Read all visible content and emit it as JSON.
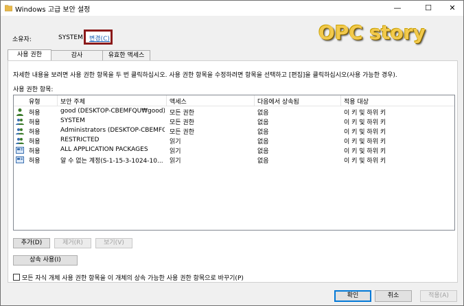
{
  "window": {
    "title": "Windows 고급 보안 설정",
    "minimize": "—",
    "maximize": "☐",
    "close": "✕"
  },
  "owner": {
    "label": "소유자:",
    "value": "SYSTEM",
    "change_link": "변경(C)"
  },
  "watermark": "OPC story",
  "tabs": [
    {
      "label": "사용 권한",
      "active": true
    },
    {
      "label": "감사",
      "active": false
    },
    {
      "label": "유효한 액세스",
      "active": false
    }
  ],
  "description": "자세한 내용을 보려면 사용 권한 항목을 두 번 클릭하십시오. 사용 권한 항목을 수정하려면 항목을 선택하고 [편집]을 클릭하십시오(사용 가능한 경우).",
  "entries_label": "사용 권한 항목:",
  "columns": [
    "유형",
    "보안 주체",
    "액세스",
    "다음에서 상속됨",
    "적용 대상"
  ],
  "rows": [
    {
      "icon": "user-icon",
      "type": "허용",
      "principal": "good (DESKTOP-CBEMFQU₩good)",
      "access": "모든 권한",
      "inherited": "없음",
      "applies": "이 키 및 하위 키"
    },
    {
      "icon": "group-icon",
      "type": "허용",
      "principal": "SYSTEM",
      "access": "모든 권한",
      "inherited": "없음",
      "applies": "이 키 및 하위 키"
    },
    {
      "icon": "group-icon",
      "type": "허용",
      "principal": "Administrators (DESKTOP-CBEMFQ...",
      "access": "모든 권한",
      "inherited": "없음",
      "applies": "이 키 및 하위 키"
    },
    {
      "icon": "group-icon",
      "type": "허용",
      "principal": "RESTRICTED",
      "access": "읽기",
      "inherited": "없음",
      "applies": "이 키 및 하위 키"
    },
    {
      "icon": "package-icon",
      "type": "허용",
      "principal": "ALL APPLICATION PACKAGES",
      "access": "읽기",
      "inherited": "없음",
      "applies": "이 키 및 하위 키"
    },
    {
      "icon": "package-icon",
      "type": "허용",
      "principal": "알 수 없는 계정(S-1-15-3-1024-10...",
      "access": "읽기",
      "inherited": "없음",
      "applies": "이 키 및 하위 키"
    }
  ],
  "buttons": {
    "add": "추가(D)",
    "remove": "제거(R)",
    "view": "보기(V)",
    "enable_inheritance": "상속 사용(I)"
  },
  "replace_checkbox": "모든 자식 개체 사용 권한 항목을 이 개체의 상속 가능한 사용 권한 항목으로 바꾸기(P)",
  "footer": {
    "ok": "확인",
    "cancel": "취소",
    "apply": "적용(A)"
  },
  "colors": {
    "highlight_box": "#8b1a1a",
    "link": "#1a5fb4",
    "watermark": "#f2c94c"
  }
}
